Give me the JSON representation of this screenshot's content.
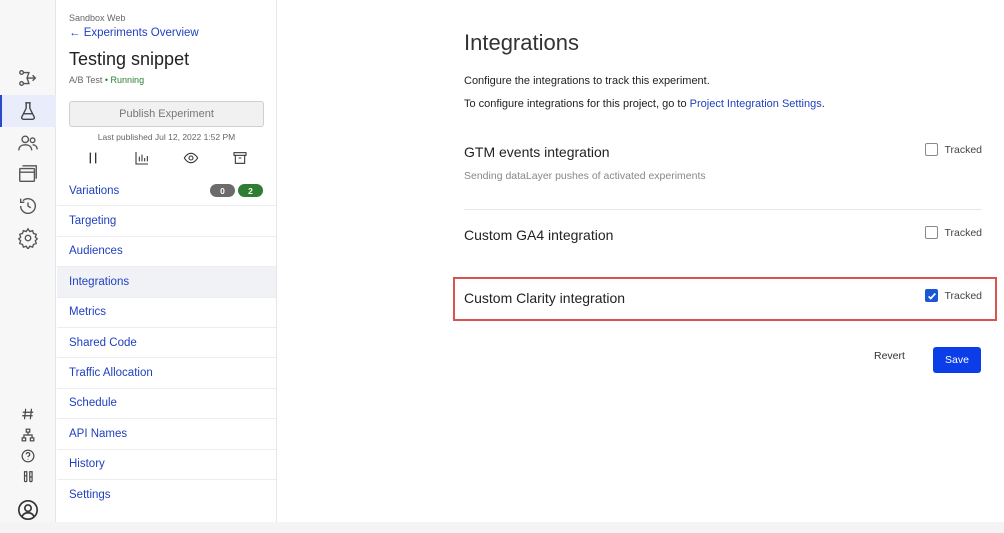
{
  "sidebar": {
    "project_name": "Sandbox Web",
    "back_link": "Experiments Overview",
    "experiment_title": "Testing snippet",
    "experiment_type": "A/B Test",
    "status": "Running",
    "publish_button": "Publish Experiment",
    "last_published": "Last published Jul 12, 2022 1:52 PM",
    "tools": [
      "pause-icon",
      "chart-icon",
      "eye-icon",
      "archive-icon"
    ],
    "nav_items": [
      {
        "label": "Variations",
        "badges": [
          "0",
          "2"
        ]
      },
      {
        "label": "Targeting"
      },
      {
        "label": "Audiences"
      },
      {
        "label": "Integrations",
        "active": true
      },
      {
        "label": "Metrics"
      },
      {
        "label": "Shared Code"
      },
      {
        "label": "Traffic Allocation"
      },
      {
        "label": "Schedule"
      },
      {
        "label": "API Names"
      },
      {
        "label": "History"
      },
      {
        "label": "Settings"
      }
    ]
  },
  "rail_icons": [
    "flow-icon",
    "flask-icon",
    "users-icon",
    "windows-icon",
    "history-icon",
    "gear-icon",
    "hash-icon",
    "sitemap-icon",
    "help-icon",
    "labs-icon",
    "avatar-icon"
  ],
  "main": {
    "title": "Integrations",
    "description": "Configure the integrations to track this experiment.",
    "project_prefix": "To configure integrations for this project, go to",
    "project_link": "Project Integration Settings",
    "project_suffix": ".",
    "integrations": [
      {
        "name": "GTM events integration",
        "description": "Sending dataLayer pushes of activated experiments",
        "tracked_label": "Tracked",
        "checked": false
      },
      {
        "name": "Custom GA4 integration",
        "tracked_label": "Tracked",
        "checked": false
      },
      {
        "name": "Custom Clarity integration",
        "tracked_label": "Tracked",
        "checked": true
      }
    ],
    "revert_button": "Revert",
    "save_button": "Save"
  },
  "colors": {
    "accent": "#2040c0",
    "save": "#0b3ee8",
    "checkbox": "#1a56d6",
    "highlight": "#d9534f",
    "running": "#2e7d32"
  }
}
